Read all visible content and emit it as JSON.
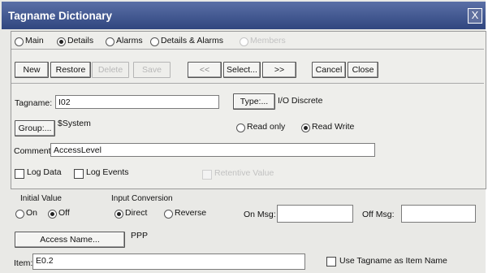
{
  "window": {
    "title": "Tagname Dictionary",
    "close_glyph": "X"
  },
  "view_options": {
    "main": "Main",
    "details": "Details",
    "alarms": "Alarms",
    "details_alarms": "Details & Alarms",
    "members": "Members",
    "selected": "details"
  },
  "toolbar": {
    "new": "New",
    "restore": "Restore",
    "delete": "Delete",
    "save": "Save",
    "prev": "<<",
    "select": "Select...",
    "next": ">>",
    "cancel": "Cancel",
    "close": "Close"
  },
  "tagname": {
    "label": "Tagname:",
    "value": "I02",
    "type_button": "Type:...",
    "type_value": "I/O Discrete"
  },
  "group": {
    "button": "Group:...",
    "value": "$System"
  },
  "access": {
    "read_only": "Read only",
    "read_write": "Read Write",
    "selected": "read_write"
  },
  "comment": {
    "label": "Comment:",
    "value": "AccessLevel"
  },
  "options": {
    "log_data": "Log Data",
    "log_events": "Log Events",
    "retentive_value": "Retentive Value"
  },
  "initial_value": {
    "label": "Initial Value",
    "on": "On",
    "off": "Off",
    "selected": "off"
  },
  "input_conversion": {
    "label": "Input Conversion",
    "direct": "Direct",
    "reverse": "Reverse",
    "selected": "direct"
  },
  "on_msg": {
    "label": "On Msg:",
    "value": ""
  },
  "off_msg": {
    "label": "Off Msg:",
    "value": ""
  },
  "access_name": {
    "button": "Access Name...",
    "value": "PPP"
  },
  "item": {
    "label": "Item:",
    "value": "E0.2",
    "use_tagname_label": "Use Tagname as Item Name"
  }
}
